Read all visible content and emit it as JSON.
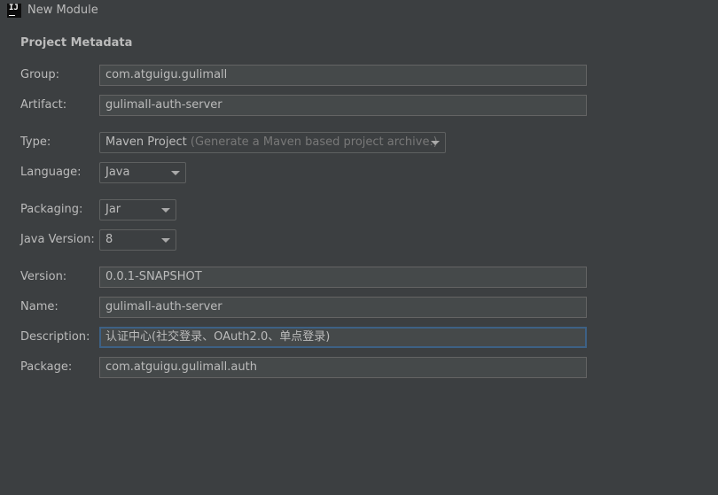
{
  "window": {
    "title": "New Module",
    "app_icon_text": "IJ"
  },
  "section": {
    "title": "Project Metadata"
  },
  "form": {
    "group": {
      "label": "Group:",
      "value": "com.atguigu.gulimall"
    },
    "artifact": {
      "label": "Artifact:",
      "value": "gulimall-auth-server"
    },
    "type": {
      "label": "Type:",
      "value": "Maven Project",
      "hint": "(Generate a Maven based project archive.)"
    },
    "language": {
      "label": "Language:",
      "value": "Java"
    },
    "packaging": {
      "label": "Packaging:",
      "value": "Jar"
    },
    "java_version": {
      "label": "Java Version:",
      "value": "8"
    },
    "version": {
      "label": "Version:",
      "value": "0.0.1-SNAPSHOT"
    },
    "name": {
      "label": "Name:",
      "value": "gulimall-auth-server"
    },
    "description": {
      "label": "Description:",
      "value": "认证中心(社交登录、OAuth2.0、单点登录)"
    },
    "package": {
      "label": "Package:",
      "value": "com.atguigu.gulimall.auth"
    }
  },
  "colors": {
    "background": "#3c3f41",
    "field_bg": "#45494a",
    "focus_border": "#3d6185",
    "text": "#bbbbbb",
    "hint": "#787878"
  },
  "icons": {
    "app": "intellij-idea-icon",
    "dropdown": "chevron-down-icon"
  }
}
